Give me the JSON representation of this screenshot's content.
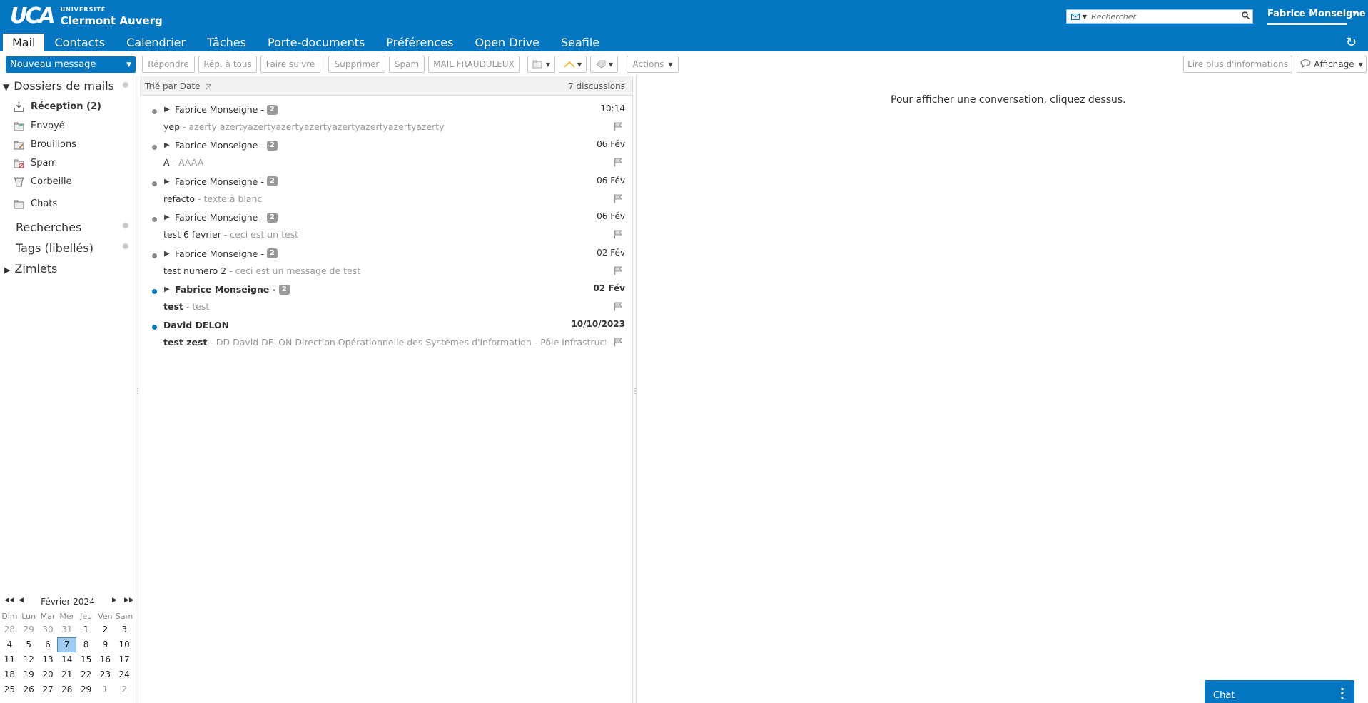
{
  "header": {
    "logo_mark": "UCA",
    "logo_small": "UNIVERSITÉ",
    "logo_big": "Clermont Auverg",
    "search_placeholder": "Rechercher",
    "user_name": "Fabrice Monseigne",
    "tabs": [
      "Mail",
      "Contacts",
      "Calendrier",
      "Tâches",
      "Porte-documents",
      "Préférences",
      "Open Drive",
      "Seafile"
    ],
    "active_tab": "Mail"
  },
  "toolbar": {
    "new_message": "Nouveau message",
    "reply": "Répondre",
    "reply_all": "Rép. à tous",
    "forward": "Faire suivre",
    "delete": "Supprimer",
    "spam": "Spam",
    "fraud": "MAIL FRAUDULEUX",
    "actions": "Actions",
    "read_more": "Lire plus d'informations",
    "view": "Affichage"
  },
  "sidebar": {
    "mail_folders": "Dossiers de mails",
    "folders": [
      {
        "label": "Réception (2)",
        "bold": true,
        "icon": "inbox-icon"
      },
      {
        "label": "Envoyé",
        "bold": false,
        "icon": "sent-icon"
      },
      {
        "label": "Brouillons",
        "bold": false,
        "icon": "drafts-icon"
      },
      {
        "label": "Spam",
        "bold": false,
        "icon": "spam-icon"
      },
      {
        "label": "Corbeille",
        "bold": false,
        "icon": "trash-icon"
      },
      {
        "label": "Chats",
        "bold": false,
        "icon": "chats-icon"
      }
    ],
    "searches": "Recherches",
    "tags": "Tags (libellés)",
    "zimlets": "Zimlets"
  },
  "calendar": {
    "title": "Février 2024",
    "weekdays": [
      "Dim",
      "Lun",
      "Mar",
      "Mer",
      "Jeu",
      "Ven",
      "Sam"
    ],
    "weeks": [
      [
        "28",
        "29",
        "30",
        "31",
        "1",
        "2",
        "3"
      ],
      [
        "4",
        "5",
        "6",
        "7",
        "8",
        "9",
        "10"
      ],
      [
        "11",
        "12",
        "13",
        "14",
        "15",
        "16",
        "17"
      ],
      [
        "18",
        "19",
        "20",
        "21",
        "22",
        "23",
        "24"
      ],
      [
        "25",
        "26",
        "27",
        "28",
        "29",
        "1",
        "2"
      ]
    ],
    "today": "7"
  },
  "list": {
    "sort_label": "Trié par Date",
    "count": "7 discussions",
    "conversations": [
      {
        "sender": "Fabrice Monseigne -",
        "count": "2",
        "date": "10:14",
        "subject": "yep",
        "fragment": " - azerty azertyazertyazertyazertyazertyazertyazertyazerty",
        "unread": false,
        "thread": true
      },
      {
        "sender": "Fabrice Monseigne -",
        "count": "2",
        "date": "06 Fév",
        "subject": "A",
        "fragment": " - AAAA",
        "unread": false,
        "thread": true
      },
      {
        "sender": "Fabrice Monseigne -",
        "count": "2",
        "date": "06 Fév",
        "subject": "refacto",
        "fragment": " - texte à blanc",
        "unread": false,
        "thread": true
      },
      {
        "sender": "Fabrice Monseigne -",
        "count": "2",
        "date": "06 Fév",
        "subject": "test 6 fevrier",
        "fragment": " - ceci est un test",
        "unread": false,
        "thread": true
      },
      {
        "sender": "Fabrice Monseigne -",
        "count": "2",
        "date": "02 Fév",
        "subject": "test numero 2",
        "fragment": " - ceci est un message de test",
        "unread": false,
        "thread": true
      },
      {
        "sender": "Fabrice Monseigne -",
        "count": "2",
        "date": "02 Fév",
        "subject": "test",
        "fragment": " - test",
        "unread": true,
        "thread": true
      },
      {
        "sender": "David DELON",
        "count": "",
        "date": "10/10/2023",
        "subject": "test zest",
        "fragment": " - DD David DELON Direction Opérationnelle des Systèmes d'Information - Pôle Infrastructures [ http://",
        "unread": true,
        "thread": false
      }
    ]
  },
  "reading": {
    "empty_message": "Pour afficher une conversation, cliquez dessus."
  },
  "chat": {
    "label": "Chat"
  },
  "colors": {
    "brand": "#0577c2",
    "unread_dot": "#0577c2",
    "read_dot": "#8c8c8c"
  }
}
